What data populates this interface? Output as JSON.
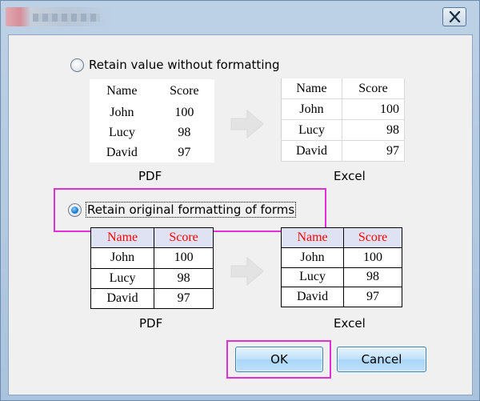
{
  "window": {
    "close_label": "✕"
  },
  "option_plain": {
    "label": "Retain value without formatting",
    "checked": false
  },
  "option_formatted": {
    "label": "Retain original formatting of forms",
    "checked": true
  },
  "tables": {
    "header": [
      "Name",
      "Score"
    ],
    "rows": [
      [
        "John",
        "100"
      ],
      [
        "Lucy",
        "98"
      ],
      [
        "David",
        "97"
      ]
    ]
  },
  "captions": {
    "pdf": "PDF",
    "excel": "Excel"
  },
  "buttons": {
    "ok": "OK",
    "cancel": "Cancel"
  },
  "colors": {
    "highlight": "#e12ed5",
    "header_text": "#ff0000",
    "header_fill": "#dfe2f3"
  },
  "icons": {
    "close": "close-icon",
    "arrow": "arrow-right-icon"
  }
}
